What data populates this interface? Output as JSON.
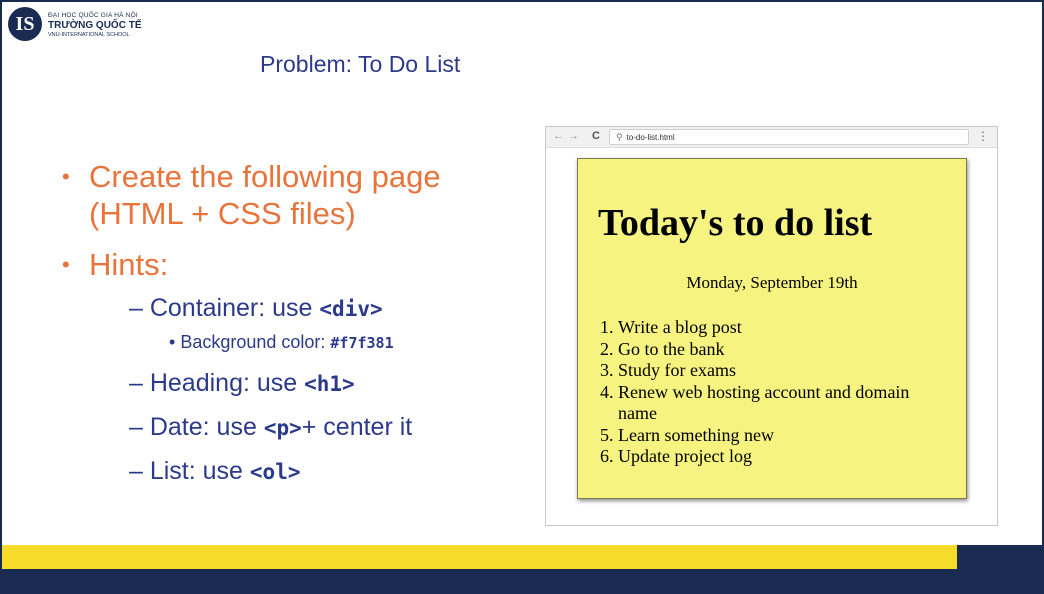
{
  "header": {
    "logo_letter": "IS",
    "logo_line1": "ĐẠI HỌC QUỐC GIA HÀ NỘI",
    "logo_line2": "TRƯỜNG QUỐC TẾ",
    "logo_line3": "VNU-INTERNATIONAL SCHOOL",
    "title": "Problem: To Do List"
  },
  "bullets": {
    "main1": "Create the following page (HTML + CSS files)",
    "main2": "Hints:",
    "h1_text": "– Container: use ",
    "h1_code": "<div>",
    "h1a_text": "Background color: ",
    "h1a_code": "#f7f381",
    "h2_text": "– Heading: use ",
    "h2_code": "<h1>",
    "h3_text": "– Date: use ",
    "h3_code": "<p>",
    "h3_suffix": "+ center it",
    "h4_text": "– List: use ",
    "h4_code": "<ol>"
  },
  "browser": {
    "back_icon": "←",
    "forward_icon": "→",
    "reload_icon": "C",
    "search_icon": "⚲",
    "url": "to-do-list.html",
    "menu_icon": "⋮"
  },
  "todo": {
    "heading": "Today's to do list",
    "date": "Monday, September 19th",
    "items": [
      "Write a blog post",
      "Go to the bank",
      "Study for exams",
      "Renew web hosting account and domain name",
      "Learn something new",
      "Update project log"
    ],
    "bg_color": "#f7f381"
  },
  "colors": {
    "navy": "#1a2b52",
    "accent_orange": "#e8743b",
    "text_blue": "#2b3a8a",
    "bar_yellow": "#f5dc2a"
  }
}
